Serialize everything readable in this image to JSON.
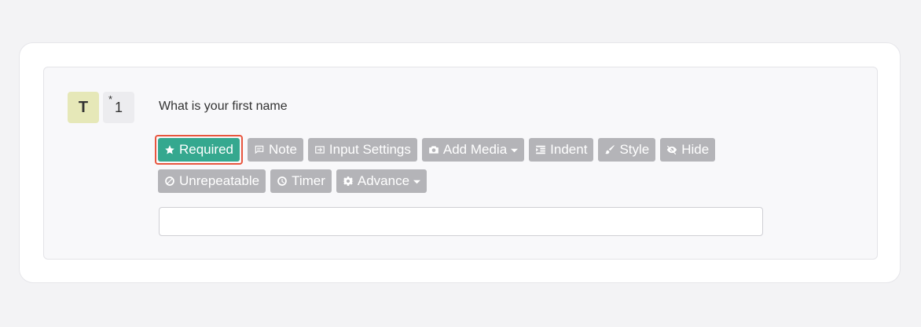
{
  "question": {
    "type_letter": "T",
    "required_mark": "*",
    "number": "1",
    "text": "What is your first name"
  },
  "toolbar": {
    "required": "Required",
    "note": "Note",
    "input_settings": "Input Settings",
    "add_media": "Add Media",
    "indent": "Indent",
    "style": "Style",
    "hide": "Hide",
    "unrepeatable": "Unrepeatable",
    "timer": "Timer",
    "advance": "Advance"
  },
  "answer": {
    "value": "",
    "placeholder": ""
  },
  "colors": {
    "required_active": "#35a88f",
    "highlight_border": "#e8553e",
    "button_inactive": "#b4b4b8",
    "type_badge": "#e6e8b8"
  }
}
